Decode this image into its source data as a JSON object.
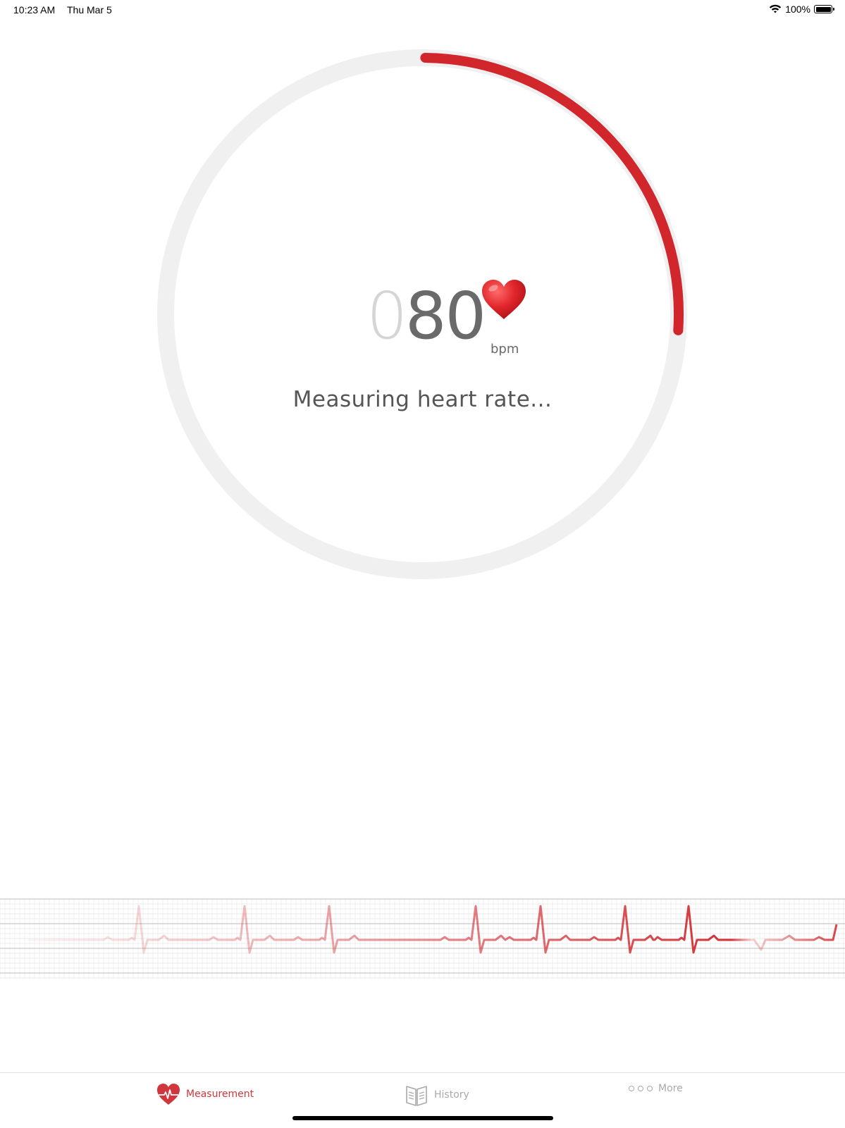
{
  "status_bar": {
    "time": "10:23 AM",
    "date": "Thu Mar 5",
    "battery_percent": "100%",
    "icons": [
      "wifi-icon",
      "battery-icon"
    ]
  },
  "measurement": {
    "leading_digit": "0",
    "value": "80",
    "unit": "bpm",
    "status_text": "Measuring heart rate...",
    "progress_fraction": 0.26,
    "colors": {
      "accent": "#d0262c",
      "track": "#f0f0f0",
      "value_text": "#6a6a6a",
      "leading_digit": "#d5d5d5"
    }
  },
  "tabbar": {
    "tabs": [
      {
        "label": "Measurement",
        "icon": "heart-pulse-icon",
        "active": true
      },
      {
        "label": "History",
        "icon": "book-icon",
        "active": false
      },
      {
        "label": "More",
        "icon": "more-dots-icon",
        "active": false
      }
    ],
    "active_color": "#d0363b",
    "inactive_color": "#a9a9a9"
  }
}
